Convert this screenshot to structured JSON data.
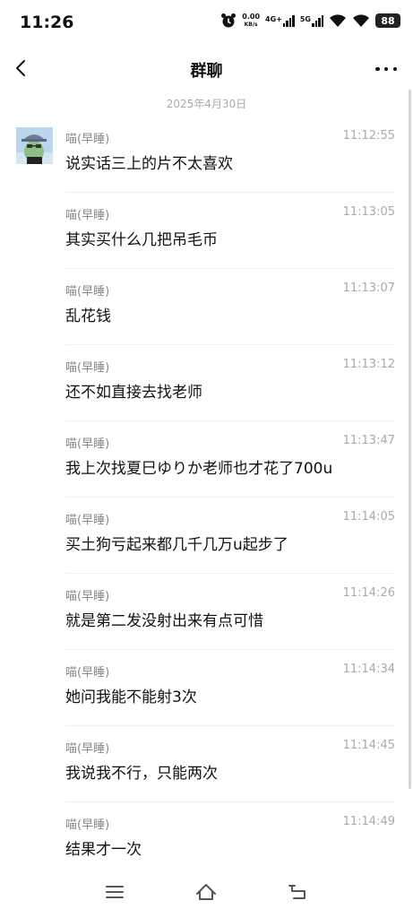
{
  "status_bar": {
    "time": "11:26",
    "net_speed_value": "0.00",
    "net_speed_unit": "KB/s",
    "signal1_label": "4G+",
    "signal2_label": "5G",
    "battery": "88"
  },
  "header": {
    "title": "群聊"
  },
  "date_label": "2025年4月30日",
  "messages": [
    {
      "sender": "喵(早睡)",
      "time": "11:12:55",
      "text": "说实话三上的片不太喜欢"
    },
    {
      "sender": "喵(早睡)",
      "time": "11:13:05",
      "text": "其实买什么几把吊毛币"
    },
    {
      "sender": "喵(早睡)",
      "time": "11:13:07",
      "text": "乱花钱"
    },
    {
      "sender": "喵(早睡)",
      "time": "11:13:12",
      "text": "还不如直接去找老师"
    },
    {
      "sender": "喵(早睡)",
      "time": "11:13:47",
      "text": "我上次找夏巳ゆりか老师也才花了700u"
    },
    {
      "sender": "喵(早睡)",
      "time": "11:14:05",
      "text": "买土狗亏起来都几千几万u起步了"
    },
    {
      "sender": "喵(早睡)",
      "time": "11:14:26",
      "text": "就是第二发没射出来有点可惜"
    },
    {
      "sender": "喵(早睡)",
      "time": "11:14:34",
      "text": "她问我能不能射3次"
    },
    {
      "sender": "喵(早睡)",
      "time": "11:14:45",
      "text": "我说我不行，只能两次"
    },
    {
      "sender": "喵(早睡)",
      "time": "11:14:49",
      "text": "结果才一次"
    }
  ],
  "icons": {
    "back": "back-arrow-icon",
    "more": "more-dots-icon",
    "nav": [
      "menu-icon",
      "home-icon",
      "back-icon"
    ]
  }
}
